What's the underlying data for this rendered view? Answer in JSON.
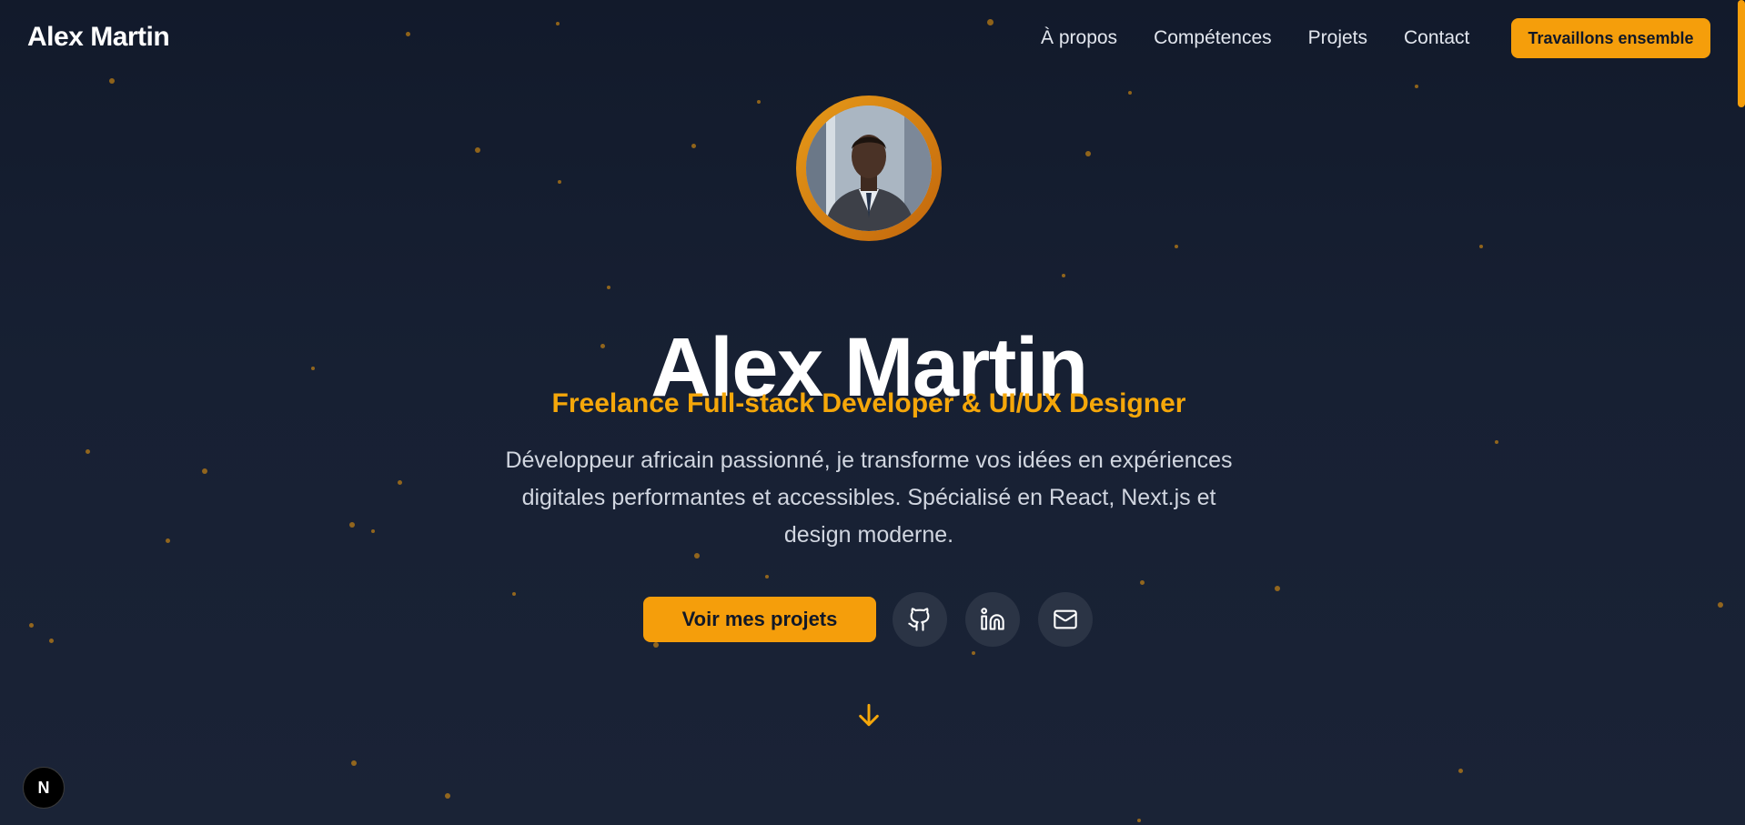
{
  "header": {
    "brand": "Alex Martin",
    "nav": [
      "À propos",
      "Compétences",
      "Projets",
      "Contact"
    ],
    "cta": "Travaillons ensemble"
  },
  "hero": {
    "avatar_alt": "portrait",
    "name": "Alex Martin",
    "subtitle": "Freelance Full-stack Developer & UI/UX Designer",
    "description": "Développeur africain passionné, je transforme vos idées en expériences digitales performantes et accessibles. Spécialisé en React, Next.js et design moderne.",
    "primary_button": "Voir mes projets",
    "social_icons": [
      "github-icon",
      "linkedin-icon",
      "mail-icon"
    ],
    "scroll_icon": "arrow-down-icon"
  },
  "dev_badge": "N",
  "colors": {
    "accent": "#f59e0b",
    "background": "#151d2e",
    "icon_button": "#2b3445"
  }
}
